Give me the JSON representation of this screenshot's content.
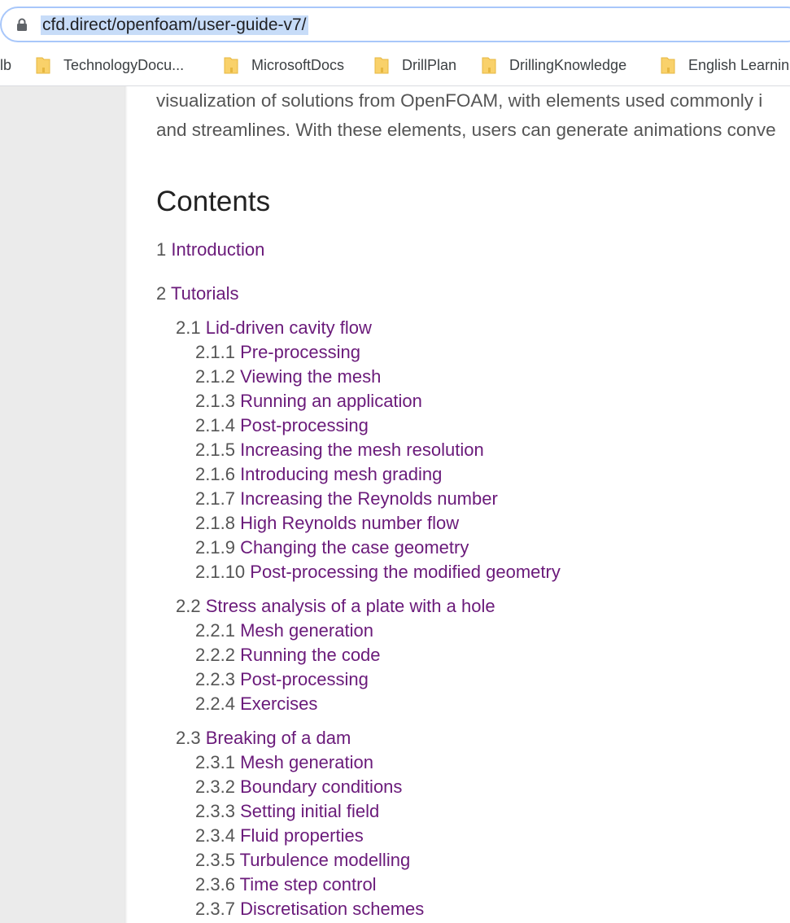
{
  "browser": {
    "url": "cfd.direct/openfoam/user-guide-v7/",
    "bookmarks": [
      "lb",
      "TechnologyDocu...",
      "MicrosoftDocs",
      "DrillPlan",
      "DrillingKnowledge",
      "English Learnin"
    ]
  },
  "colors": {
    "link": "#6a1a7a",
    "text": "#555555",
    "heading": "#222222",
    "gutter": "#ebebeb",
    "url_highlight": "#c7dcf8"
  },
  "intro": {
    "line1": "visualization of solutions from OpenFOAM, with elements used commonly i",
    "line2": "and streamlines.  With these elements, users can generate animations conve"
  },
  "contents": {
    "heading": "Contents",
    "items": [
      {
        "num": "1",
        "title": "Introduction"
      },
      {
        "num": "2",
        "title": "Tutorials"
      },
      {
        "num": "2.1",
        "title": "Lid-driven cavity flow"
      },
      {
        "num": "2.1.1",
        "title": "Pre-processing"
      },
      {
        "num": "2.1.2",
        "title": "Viewing the mesh"
      },
      {
        "num": "2.1.3",
        "title": "Running an application"
      },
      {
        "num": "2.1.4",
        "title": "Post-processing"
      },
      {
        "num": "2.1.5",
        "title": "Increasing the mesh resolution"
      },
      {
        "num": "2.1.6",
        "title": "Introducing mesh grading"
      },
      {
        "num": "2.1.7",
        "title": "Increasing the Reynolds number"
      },
      {
        "num": "2.1.8",
        "title": "High Reynolds number flow"
      },
      {
        "num": "2.1.9",
        "title": "Changing the case geometry"
      },
      {
        "num": "2.1.10",
        "title": "Post-processing the modified geometry"
      },
      {
        "num": "2.2",
        "title": "Stress analysis of a plate with a hole"
      },
      {
        "num": "2.2.1",
        "title": "Mesh generation"
      },
      {
        "num": "2.2.2",
        "title": "Running the code"
      },
      {
        "num": "2.2.3",
        "title": "Post-processing"
      },
      {
        "num": "2.2.4",
        "title": "Exercises"
      },
      {
        "num": "2.3",
        "title": "Breaking of a dam"
      },
      {
        "num": "2.3.1",
        "title": "Mesh generation"
      },
      {
        "num": "2.3.2",
        "title": "Boundary conditions"
      },
      {
        "num": "2.3.3",
        "title": "Setting initial field"
      },
      {
        "num": "2.3.4",
        "title": "Fluid properties"
      },
      {
        "num": "2.3.5",
        "title": "Turbulence modelling"
      },
      {
        "num": "2.3.6",
        "title": "Time step control"
      },
      {
        "num": "2.3.7",
        "title": "Discretisation schemes"
      }
    ]
  }
}
